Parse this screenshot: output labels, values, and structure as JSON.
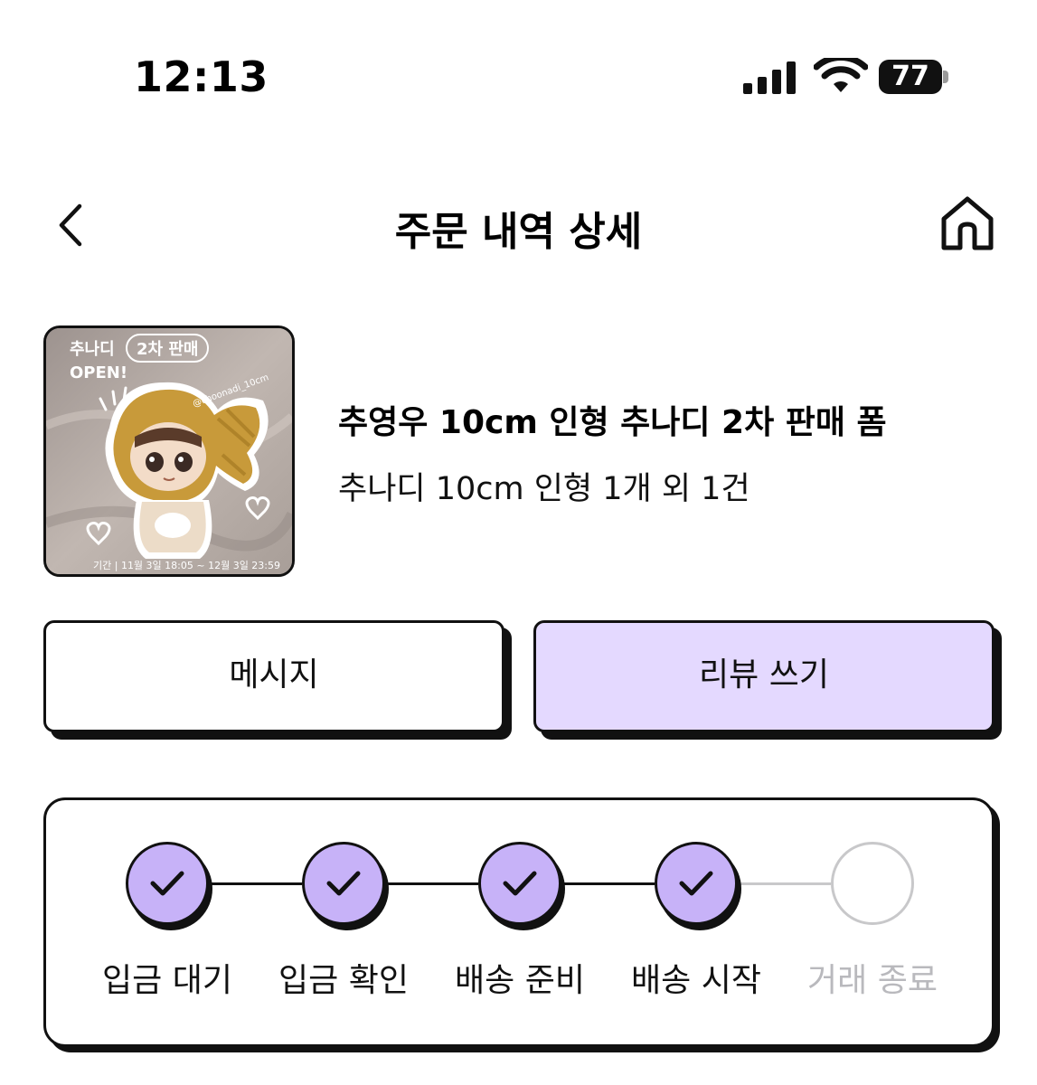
{
  "status_bar": {
    "time": "12:13",
    "battery": "77",
    "icons": [
      "signal-icon",
      "wifi-icon",
      "battery-icon"
    ]
  },
  "header": {
    "title": "주문 내역 상세",
    "back_icon": "chevron-left-icon",
    "home_icon": "home-icon"
  },
  "product": {
    "title": "추영우 10cm 인형 추나디 2차 판매 폼",
    "subtitle": "추나디 10cm 인형 1개 외 1건",
    "thumbnail": {
      "headline_left": "추나디",
      "headline_pill": "2차 판매",
      "headline_right": "OPEN!",
      "handle": "@choonadi_10cm",
      "footer": "기간 | 11월 3일 18:05 ~ 12월 3일 23:59"
    }
  },
  "actions": {
    "message_label": "메시지",
    "review_label": "리뷰 쓰기"
  },
  "progress": {
    "steps": [
      {
        "label": "입금 대기",
        "done": true
      },
      {
        "label": "입금 확인",
        "done": true
      },
      {
        "label": "배송 준비",
        "done": true
      },
      {
        "label": "배송 시작",
        "done": true
      },
      {
        "label": "거래 종료",
        "done": false
      }
    ]
  },
  "colors": {
    "accent": "#c7b2f8",
    "review_button": "#e4d9ff",
    "inactive": "#c8c8ca",
    "border": "#111111"
  }
}
